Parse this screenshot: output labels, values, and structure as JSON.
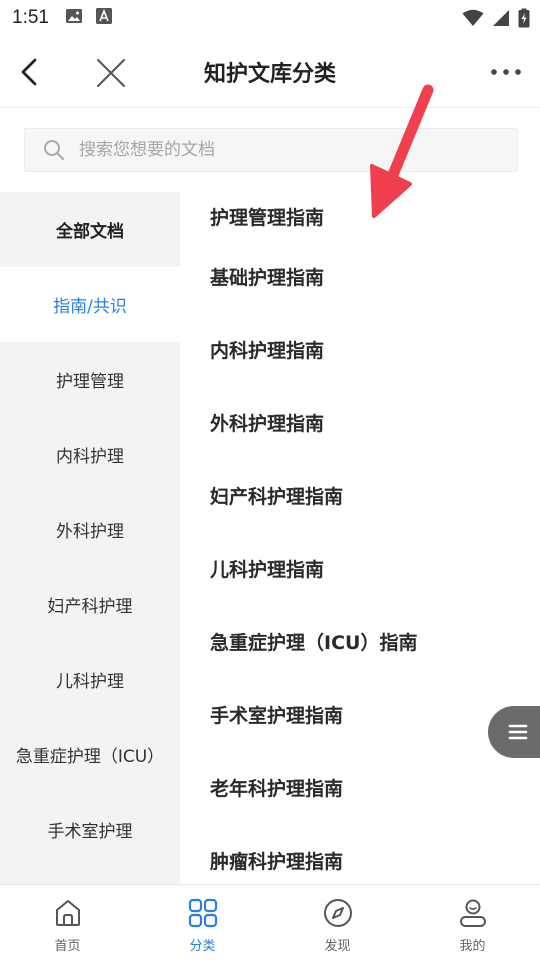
{
  "status_bar": {
    "time": "1:51"
  },
  "header": {
    "title": "知护文库分类",
    "back_icon": "back-arrow-icon",
    "close_icon": "close-icon",
    "more_icon": "more-dots-icon"
  },
  "search": {
    "placeholder": "搜索您想要的文档",
    "value": ""
  },
  "sidebar": {
    "items": [
      {
        "label": "全部文档"
      },
      {
        "label": "指南/共识",
        "active": true
      },
      {
        "label": "护理管理"
      },
      {
        "label": "内科护理"
      },
      {
        "label": "外科护理"
      },
      {
        "label": "妇产科护理"
      },
      {
        "label": "儿科护理"
      },
      {
        "label": "急重症护理（ICU）"
      },
      {
        "label": "手术室护理"
      }
    ]
  },
  "content": {
    "items": [
      {
        "label": "护理管理指南"
      },
      {
        "label": "基础护理指南"
      },
      {
        "label": "内科护理指南"
      },
      {
        "label": "外科护理指南"
      },
      {
        "label": "妇产科护理指南"
      },
      {
        "label": "儿科护理指南"
      },
      {
        "label": "急重症护理（ICU）指南"
      },
      {
        "label": "手术室护理指南"
      },
      {
        "label": "老年科护理指南"
      },
      {
        "label": "肿瘤科护理指南"
      }
    ]
  },
  "bottom_nav": {
    "items": [
      {
        "label": "首页",
        "icon": "home-icon"
      },
      {
        "label": "分类",
        "icon": "category-grid-icon",
        "active": true
      },
      {
        "label": "发现",
        "icon": "compass-icon"
      },
      {
        "label": "我的",
        "icon": "profile-icon"
      }
    ]
  },
  "colors": {
    "accent": "#2a7fe0",
    "sidebar_bg": "#f3f3f3",
    "annotation_arrow": "#f04050",
    "float_button": "#6b6b6b"
  }
}
